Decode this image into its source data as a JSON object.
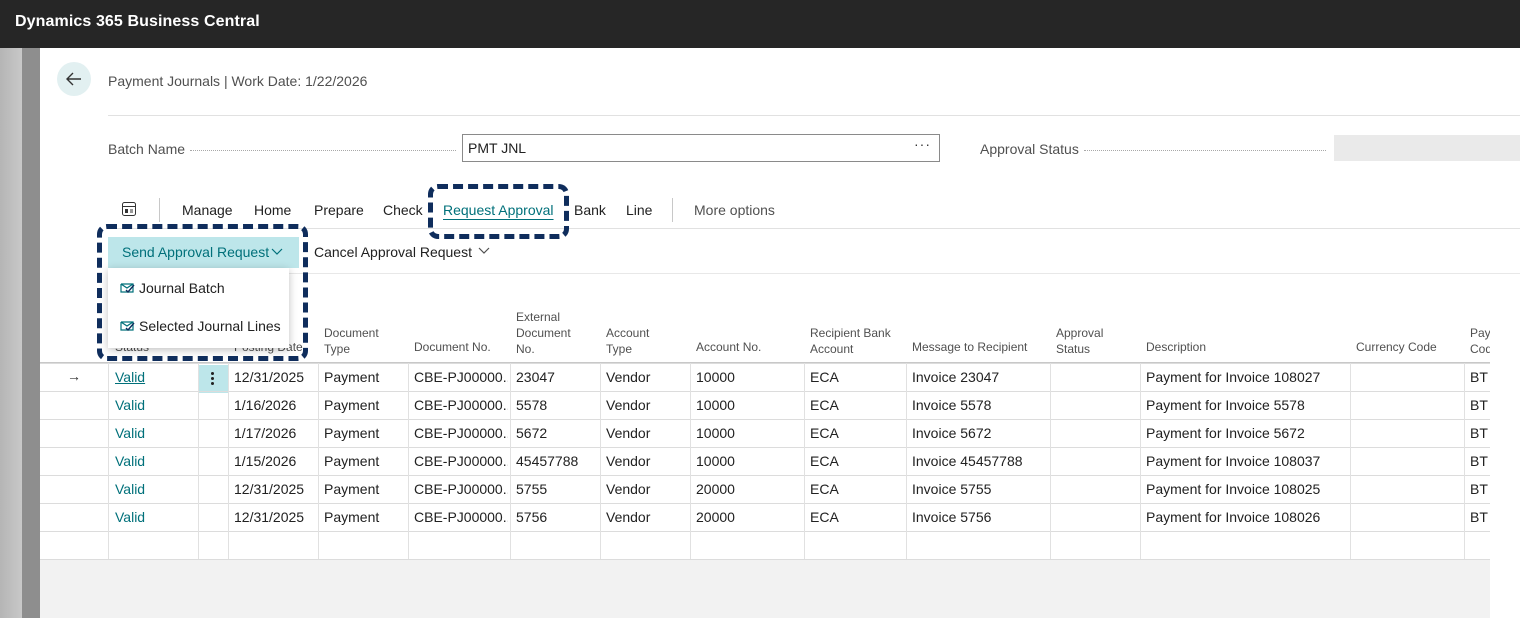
{
  "app": {
    "title": "Dynamics 365 Business Central"
  },
  "page": {
    "caption": "Payment Journals | Work Date: 1/22/2026"
  },
  "fields": {
    "batch_name_label": "Batch Name",
    "batch_name_value": "PMT JNL",
    "batch_more": "···",
    "approval_status_label": "Approval Status",
    "approval_status_value": ""
  },
  "actions": [
    "Manage",
    "Home",
    "Prepare",
    "Check",
    "Request Approval",
    "Bank",
    "Line",
    "More options"
  ],
  "subactions": {
    "send": "Send Approval Request",
    "cancel": "Cancel Approval Request"
  },
  "dropdown": [
    "Journal Batch",
    "Selected Journal Lines"
  ],
  "columns": {
    "status": "Status",
    "posting_date": "Posting Date",
    "document_type": [
      "Document",
      "Type"
    ],
    "document_no": "Document No.",
    "external_doc": [
      "External",
      "Document",
      "No."
    ],
    "account_type": [
      "Account",
      "Type"
    ],
    "account_no": "Account No.",
    "recipient_bank": [
      "Recipient Bank",
      "Account"
    ],
    "message": "Message to Recipient",
    "approval_status": [
      "Approval",
      "Status"
    ],
    "description": "Description",
    "currency": "Currency Code",
    "payment_code": [
      "Payı",
      "Cod"
    ]
  },
  "rows": [
    {
      "status": "Valid",
      "date": "12/31/2025",
      "doctype": "Payment",
      "docno": "CBE-PJ00000...",
      "ext": "23047",
      "acctype": "Vendor",
      "accno": "10000",
      "bank": "ECA",
      "msg": "Invoice 23047",
      "approval": "",
      "desc": "Payment for Invoice 108027",
      "currency": "",
      "paycode": "BTD"
    },
    {
      "status": "Valid",
      "date": "1/16/2026",
      "doctype": "Payment",
      "docno": "CBE-PJ00000...",
      "ext": "5578",
      "acctype": "Vendor",
      "accno": "10000",
      "bank": "ECA",
      "msg": "Invoice 5578",
      "approval": "",
      "desc": "Payment for Invoice 5578",
      "currency": "",
      "paycode": "BTD"
    },
    {
      "status": "Valid",
      "date": "1/17/2026",
      "doctype": "Payment",
      "docno": "CBE-PJ00000...",
      "ext": "5672",
      "acctype": "Vendor",
      "accno": "10000",
      "bank": "ECA",
      "msg": "Invoice 5672",
      "approval": "",
      "desc": "Payment for Invoice 5672",
      "currency": "",
      "paycode": "BTD"
    },
    {
      "status": "Valid",
      "date": "1/15/2026",
      "doctype": "Payment",
      "docno": "CBE-PJ00000...",
      "ext": "45457788",
      "acctype": "Vendor",
      "accno": "10000",
      "bank": "ECA",
      "msg": "Invoice 45457788",
      "approval": "",
      "desc": "Payment for Invoice 108037",
      "currency": "",
      "paycode": "BTD"
    },
    {
      "status": "Valid",
      "date": "12/31/2025",
      "doctype": "Payment",
      "docno": "CBE-PJ00000...",
      "ext": "5755",
      "acctype": "Vendor",
      "accno": "20000",
      "bank": "ECA",
      "msg": "Invoice 5755",
      "approval": "",
      "desc": "Payment for Invoice 108025",
      "currency": "",
      "paycode": "BTD"
    },
    {
      "status": "Valid",
      "date": "12/31/2025",
      "doctype": "Payment",
      "docno": "CBE-PJ00000...",
      "ext": "5756",
      "acctype": "Vendor",
      "accno": "20000",
      "bank": "ECA",
      "msg": "Invoice 5756",
      "approval": "",
      "desc": "Payment for Invoice 108026",
      "currency": "",
      "paycode": "BTD"
    }
  ],
  "colors": {
    "accent": "#00707a",
    "accent_bg": "#bde6ea",
    "highlight_border": "#0f2d5c",
    "topbar": "#262626"
  }
}
